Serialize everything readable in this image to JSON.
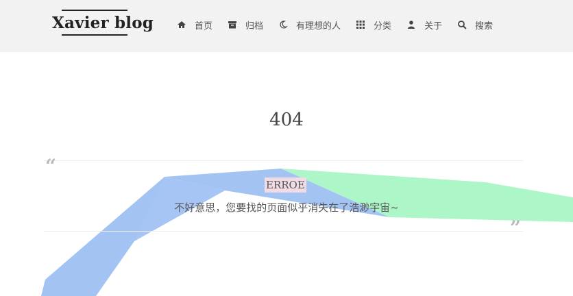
{
  "header": {
    "brand": "Xavier blog",
    "nav": [
      {
        "label": "首页",
        "icon": "home-icon"
      },
      {
        "label": "归档",
        "icon": "archive-icon"
      },
      {
        "label": "有理想的人",
        "icon": "moon-icon"
      },
      {
        "label": "分类",
        "icon": "grid-icon"
      },
      {
        "label": "关于",
        "icon": "user-icon"
      },
      {
        "label": "搜索",
        "icon": "search-icon"
      }
    ]
  },
  "main": {
    "title": "404",
    "tag": "ERROE",
    "message": "不好意思，您要找的页面似乎消失在了浩渺宇宙~",
    "quote_open": "“",
    "quote_close": "”"
  },
  "colors": {
    "header_bg": "#f2f2f2",
    "ribbon_blue": "#a3c4f3",
    "ribbon_green": "#a8f5c5",
    "tag_bg": "#f1dbe4"
  }
}
